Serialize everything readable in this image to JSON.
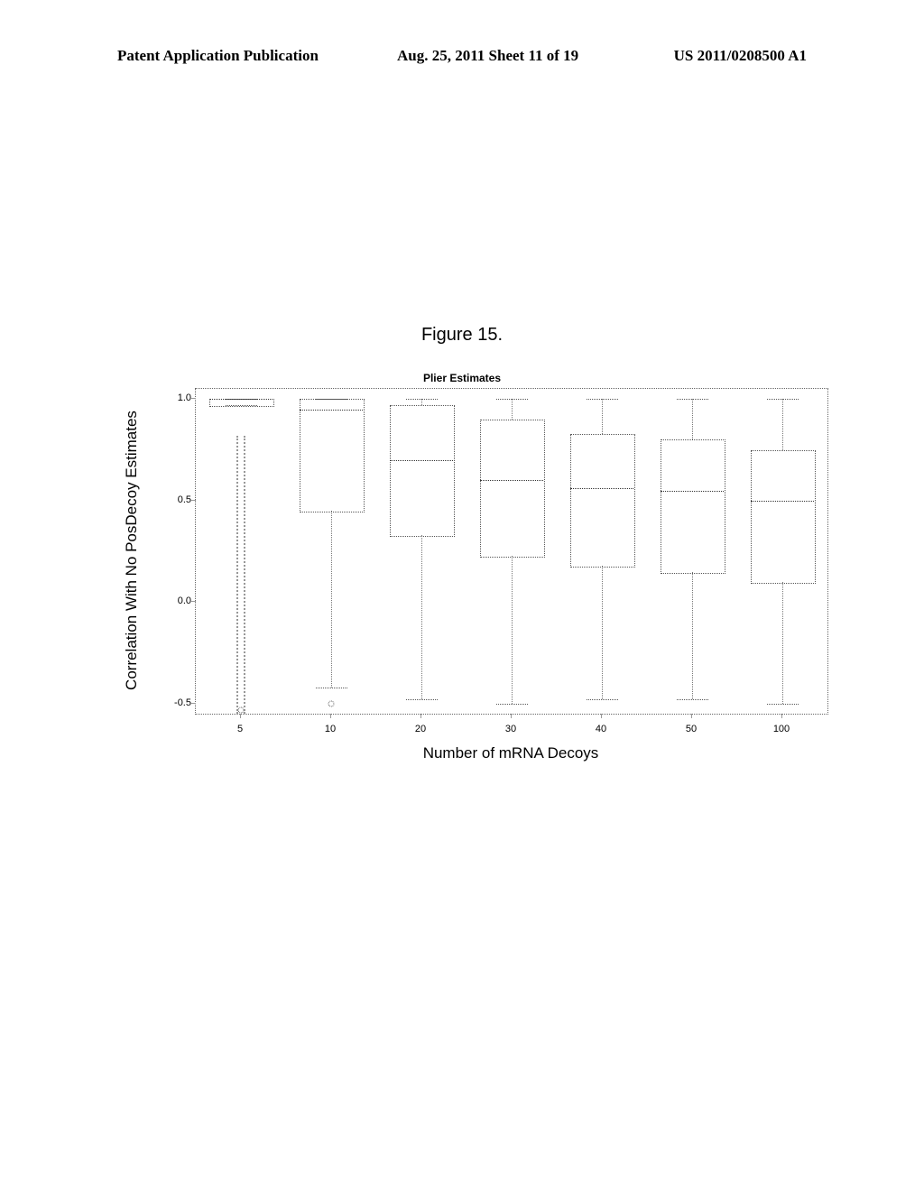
{
  "header": {
    "left": "Patent Application Publication",
    "center": "Aug. 25, 2011  Sheet 11 of 19",
    "right": "US 2011/0208500 A1"
  },
  "figure_caption": "Figure 15.",
  "chart_data": {
    "type": "boxplot",
    "title": "Plier Estimates",
    "xlabel": "Number of mRNA Decoys",
    "ylabel": "Correlation With No PosDecoy Estimates",
    "categories": [
      "5",
      "10",
      "20",
      "30",
      "40",
      "50",
      "100"
    ],
    "ylim": [
      -0.55,
      1.05
    ],
    "y_ticks": [
      -0.5,
      0.0,
      0.5,
      1.0
    ],
    "series": [
      {
        "category": "5",
        "q1": 0.97,
        "median": 1.0,
        "q3": 1.0,
        "whisker_low": 0.97,
        "whisker_high": 1.0,
        "outliers_low": -0.55,
        "outliers_high": 0.82,
        "outliers_dense": true,
        "extra_outliers": [
          -0.53
        ]
      },
      {
        "category": "10",
        "q1": 0.45,
        "median": 0.95,
        "q3": 1.0,
        "whisker_low": -0.42,
        "whisker_high": 1.0,
        "extra_outliers": [
          -0.5
        ]
      },
      {
        "category": "20",
        "q1": 0.33,
        "median": 0.7,
        "q3": 0.97,
        "whisker_low": -0.48,
        "whisker_high": 1.0
      },
      {
        "category": "30",
        "q1": 0.23,
        "median": 0.6,
        "q3": 0.9,
        "whisker_low": -0.5,
        "whisker_high": 1.0
      },
      {
        "category": "40",
        "q1": 0.18,
        "median": 0.56,
        "q3": 0.83,
        "whisker_low": -0.48,
        "whisker_high": 1.0
      },
      {
        "category": "50",
        "q1": 0.15,
        "median": 0.55,
        "q3": 0.8,
        "whisker_low": -0.48,
        "whisker_high": 1.0
      },
      {
        "category": "100",
        "q1": 0.1,
        "median": 0.5,
        "q3": 0.75,
        "whisker_low": -0.5,
        "whisker_high": 1.0
      }
    ]
  }
}
